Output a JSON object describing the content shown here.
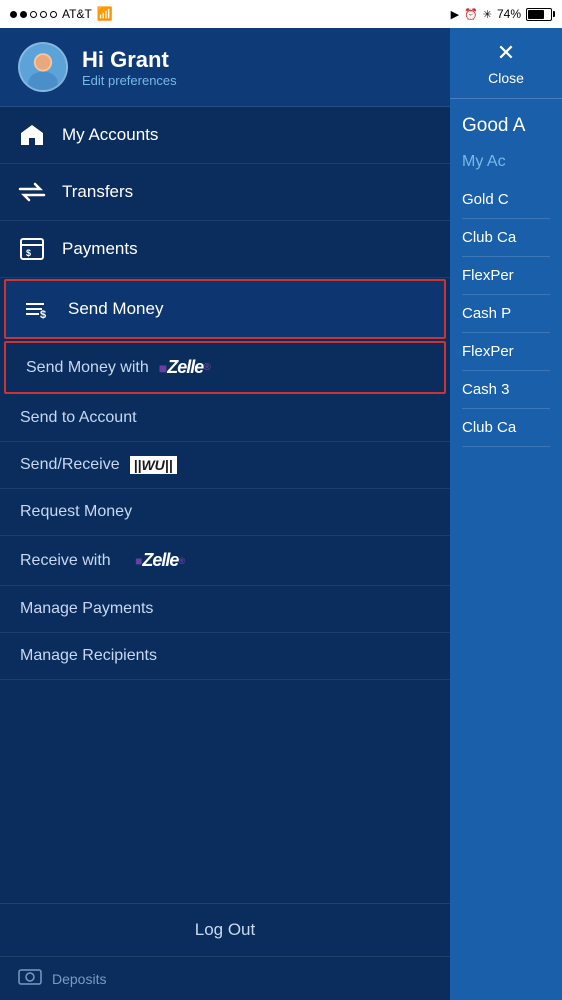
{
  "statusBar": {
    "carrier": "AT&T",
    "battery": "74%",
    "time": ""
  },
  "drawer": {
    "header": {
      "greeting": "Hi Grant",
      "editPrefs": "Edit preferences"
    },
    "navItems": [
      {
        "id": "my-accounts",
        "label": "My Accounts",
        "icon": "house"
      },
      {
        "id": "transfers",
        "label": "Transfers",
        "icon": "transfers"
      },
      {
        "id": "payments",
        "label": "Payments",
        "icon": "payments"
      },
      {
        "id": "send-money",
        "label": "Send Money",
        "icon": "send",
        "active": true,
        "highlighted": true
      }
    ],
    "subItems": [
      {
        "id": "send-money-zelle",
        "label": "Send Money with",
        "suffix": "zelle",
        "highlighted": true
      },
      {
        "id": "send-to-account",
        "label": "Send to Account"
      },
      {
        "id": "send-receive-wu",
        "label": "Send/Receive",
        "suffix": "wu"
      },
      {
        "id": "request-money",
        "label": "Request Money"
      },
      {
        "id": "receive-zelle",
        "label": "Receive with",
        "suffix": "zelle"
      },
      {
        "id": "manage-payments",
        "label": "Manage Payments"
      },
      {
        "id": "manage-recipients",
        "label": "Manage Recipients"
      }
    ],
    "logout": "Log Out",
    "deposits": "Deposits"
  },
  "rightPanel": {
    "close": "Close",
    "greeting": "Good A",
    "myAccountsTitle": "My Ac",
    "accounts": [
      "Gold C",
      "Club Ca",
      "FlexPer",
      "Cash P",
      "FlexPer",
      "Cash 3",
      "Club Ca"
    ]
  }
}
